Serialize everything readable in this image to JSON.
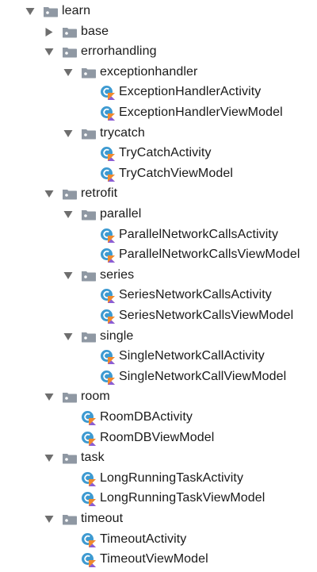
{
  "tree": [
    {
      "label": "learn",
      "type": "package",
      "depth": 0,
      "expanded": true
    },
    {
      "label": "base",
      "type": "package",
      "depth": 1,
      "expanded": false
    },
    {
      "label": "errorhandling",
      "type": "package",
      "depth": 1,
      "expanded": true
    },
    {
      "label": "exceptionhandler",
      "type": "package",
      "depth": 2,
      "expanded": true
    },
    {
      "label": "ExceptionHandlerActivity",
      "type": "kotlin-class",
      "depth": 3
    },
    {
      "label": "ExceptionHandlerViewModel",
      "type": "kotlin-class",
      "depth": 3
    },
    {
      "label": "trycatch",
      "type": "package",
      "depth": 2,
      "expanded": true
    },
    {
      "label": "TryCatchActivity",
      "type": "kotlin-class",
      "depth": 3
    },
    {
      "label": "TryCatchViewModel",
      "type": "kotlin-class",
      "depth": 3
    },
    {
      "label": "retrofit",
      "type": "package",
      "depth": 1,
      "expanded": true
    },
    {
      "label": "parallel",
      "type": "package",
      "depth": 2,
      "expanded": true
    },
    {
      "label": "ParallelNetworkCallsActivity",
      "type": "kotlin-class",
      "depth": 3
    },
    {
      "label": "ParallelNetworkCallsViewModel",
      "type": "kotlin-class",
      "depth": 3
    },
    {
      "label": "series",
      "type": "package",
      "depth": 2,
      "expanded": true
    },
    {
      "label": "SeriesNetworkCallsActivity",
      "type": "kotlin-class",
      "depth": 3
    },
    {
      "label": "SeriesNetworkCallsViewModel",
      "type": "kotlin-class",
      "depth": 3
    },
    {
      "label": "single",
      "type": "package",
      "depth": 2,
      "expanded": true
    },
    {
      "label": "SingleNetworkCallActivity",
      "type": "kotlin-class",
      "depth": 3
    },
    {
      "label": "SingleNetworkCallViewModel",
      "type": "kotlin-class",
      "depth": 3
    },
    {
      "label": "room",
      "type": "package",
      "depth": 1,
      "expanded": true
    },
    {
      "label": "RoomDBActivity",
      "type": "kotlin-class",
      "depth": 2
    },
    {
      "label": "RoomDBViewModel",
      "type": "kotlin-class",
      "depth": 2
    },
    {
      "label": "task",
      "type": "package",
      "depth": 1,
      "expanded": true
    },
    {
      "label": "LongRunningTaskActivity",
      "type": "kotlin-class",
      "depth": 2
    },
    {
      "label": "LongRunningTaskViewModel",
      "type": "kotlin-class",
      "depth": 2
    },
    {
      "label": "timeout",
      "type": "package",
      "depth": 1,
      "expanded": true
    },
    {
      "label": "TimeoutActivity",
      "type": "kotlin-class",
      "depth": 2
    },
    {
      "label": "TimeoutViewModel",
      "type": "kotlin-class",
      "depth": 2
    }
  ],
  "colors": {
    "folder_body": "#8f98a3",
    "folder_tab": "#8f98a3",
    "folder_dot": "#ffffff",
    "arrow": "#6e6e6e",
    "class_circle": "#3d9ad1",
    "kotlin_orange": "#f08a2e",
    "kotlin_purple": "#8a5cd6",
    "text": "#1a1a1a"
  }
}
